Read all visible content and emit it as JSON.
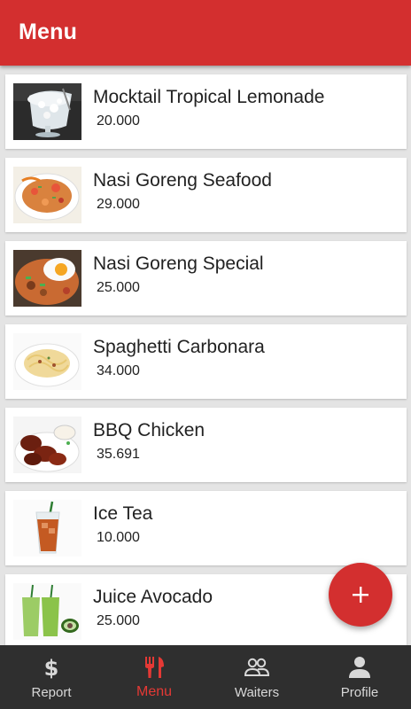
{
  "appbar": {
    "title": "Menu"
  },
  "menu": {
    "items": [
      {
        "name": "Mocktail Tropical Lemonade",
        "price": "20.000",
        "image": "lemonade-image"
      },
      {
        "name": "Nasi Goreng Seafood",
        "price": "29.000",
        "image": "nasi-goreng-seafood-image"
      },
      {
        "name": "Nasi Goreng Special",
        "price": "25.000",
        "image": "nasi-goreng-special-image"
      },
      {
        "name": "Spaghetti Carbonara",
        "price": "34.000",
        "image": "spaghetti-image"
      },
      {
        "name": "BBQ Chicken",
        "price": "35.691",
        "image": "bbq-chicken-image"
      },
      {
        "name": "Ice Tea",
        "price": "10.000",
        "image": "ice-tea-image"
      },
      {
        "name": "Juice Avocado",
        "price": "25.000",
        "image": "juice-avocado-image"
      }
    ]
  },
  "fab": {
    "icon": "plus-icon"
  },
  "nav": {
    "active": "Menu",
    "items": [
      {
        "label": "Report",
        "icon": "dollar-icon"
      },
      {
        "label": "Menu",
        "icon": "fork-knife-icon"
      },
      {
        "label": "Waiters",
        "icon": "people-icon"
      },
      {
        "label": "Profile",
        "icon": "person-icon"
      }
    ]
  },
  "colors": {
    "primary": "#d32f2f",
    "nav_background": "#2f2f2f",
    "nav_active": "#e53935",
    "list_background": "#e4e4e4"
  }
}
